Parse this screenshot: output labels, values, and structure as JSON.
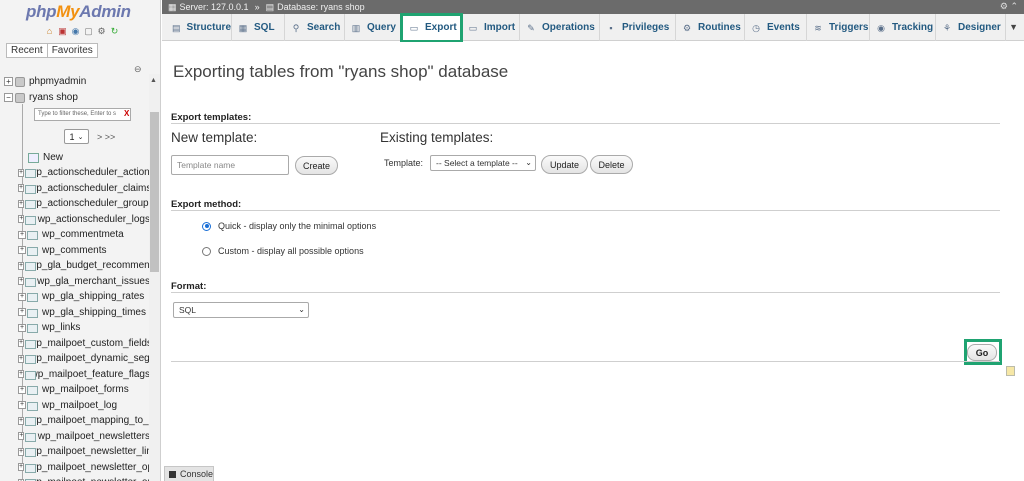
{
  "sidebar": {
    "logo": {
      "php": "php",
      "my": "My",
      "admin": "Admin"
    },
    "quick_icons": [
      "home-icon",
      "logout-icon",
      "docs-icon",
      "sql-docs-icon",
      "settings-icon",
      "reload-icon"
    ],
    "tabs": [
      "Recent",
      "Favorites"
    ],
    "collapse_label": "⊖",
    "databases": [
      {
        "name": "phpmyadmin",
        "expander": "+"
      },
      {
        "name": "ryans shop",
        "expander": "−"
      }
    ],
    "filter_placeholder": "Type to filter these, Enter to s",
    "filter_clear": "X",
    "page_number": "1",
    "page_next": "> >>",
    "new_label": "New",
    "tables": [
      "wp_actionscheduler_actions",
      "wp_actionscheduler_claims",
      "wp_actionscheduler_groups",
      "wp_actionscheduler_logs",
      "wp_commentmeta",
      "wp_comments",
      "wp_gla_budget_recommendations",
      "wp_gla_merchant_issues",
      "wp_gla_shipping_rates",
      "wp_gla_shipping_times",
      "wp_links",
      "wp_mailpoet_custom_fields",
      "wp_mailpoet_dynamic_segment_filters",
      "wp_mailpoet_feature_flags",
      "wp_mailpoet_forms",
      "wp_mailpoet_log",
      "wp_mailpoet_mapping_to_external_entities",
      "wp_mailpoet_newsletters",
      "wp_mailpoet_newsletter_links",
      "wp_mailpoet_newsletter_option",
      "wp_mailpoet_newsletter_option_fields"
    ]
  },
  "topbar": {
    "server": "Server: 127.0.0.1",
    "separator": "»",
    "database": "Database: ryans shop",
    "corner": "⚙ ⌃"
  },
  "tabs": [
    {
      "label": "Structure",
      "icon": "▤"
    },
    {
      "label": "SQL",
      "icon": "▦"
    },
    {
      "label": "Search",
      "icon": "⚲"
    },
    {
      "label": "Query",
      "icon": "▥"
    },
    {
      "label": "Export",
      "icon": "▭",
      "active": true
    },
    {
      "label": "Import",
      "icon": "▭"
    },
    {
      "label": "Operations",
      "icon": "✎"
    },
    {
      "label": "Privileges",
      "icon": "▪"
    },
    {
      "label": "Routines",
      "icon": "⚙"
    },
    {
      "label": "Events",
      "icon": "◷"
    },
    {
      "label": "Triggers",
      "icon": "≋"
    },
    {
      "label": "Tracking",
      "icon": "◉"
    },
    {
      "label": "Designer",
      "icon": "⚘"
    }
  ],
  "tabs_more": "▼",
  "main": {
    "title": "Exporting tables from \"ryans shop\" database",
    "export_templates_label": "Export templates:",
    "new_template_heading": "New template:",
    "template_name_placeholder": "Template name",
    "create_button": "Create",
    "existing_templates_heading": "Existing templates:",
    "template_label": "Template:",
    "template_select_value": "-- Select a template --",
    "update_button": "Update",
    "delete_button": "Delete",
    "export_method_label": "Export method:",
    "method_quick": "Quick - display only the minimal options",
    "method_custom": "Custom - display all possible options",
    "format_label": "Format:",
    "format_value": "SQL",
    "go_button": "Go"
  },
  "console": {
    "label": "Console"
  },
  "colors": {
    "highlight": "#1fa371",
    "link": "#235a81",
    "topbar": "#6b6b6b"
  }
}
